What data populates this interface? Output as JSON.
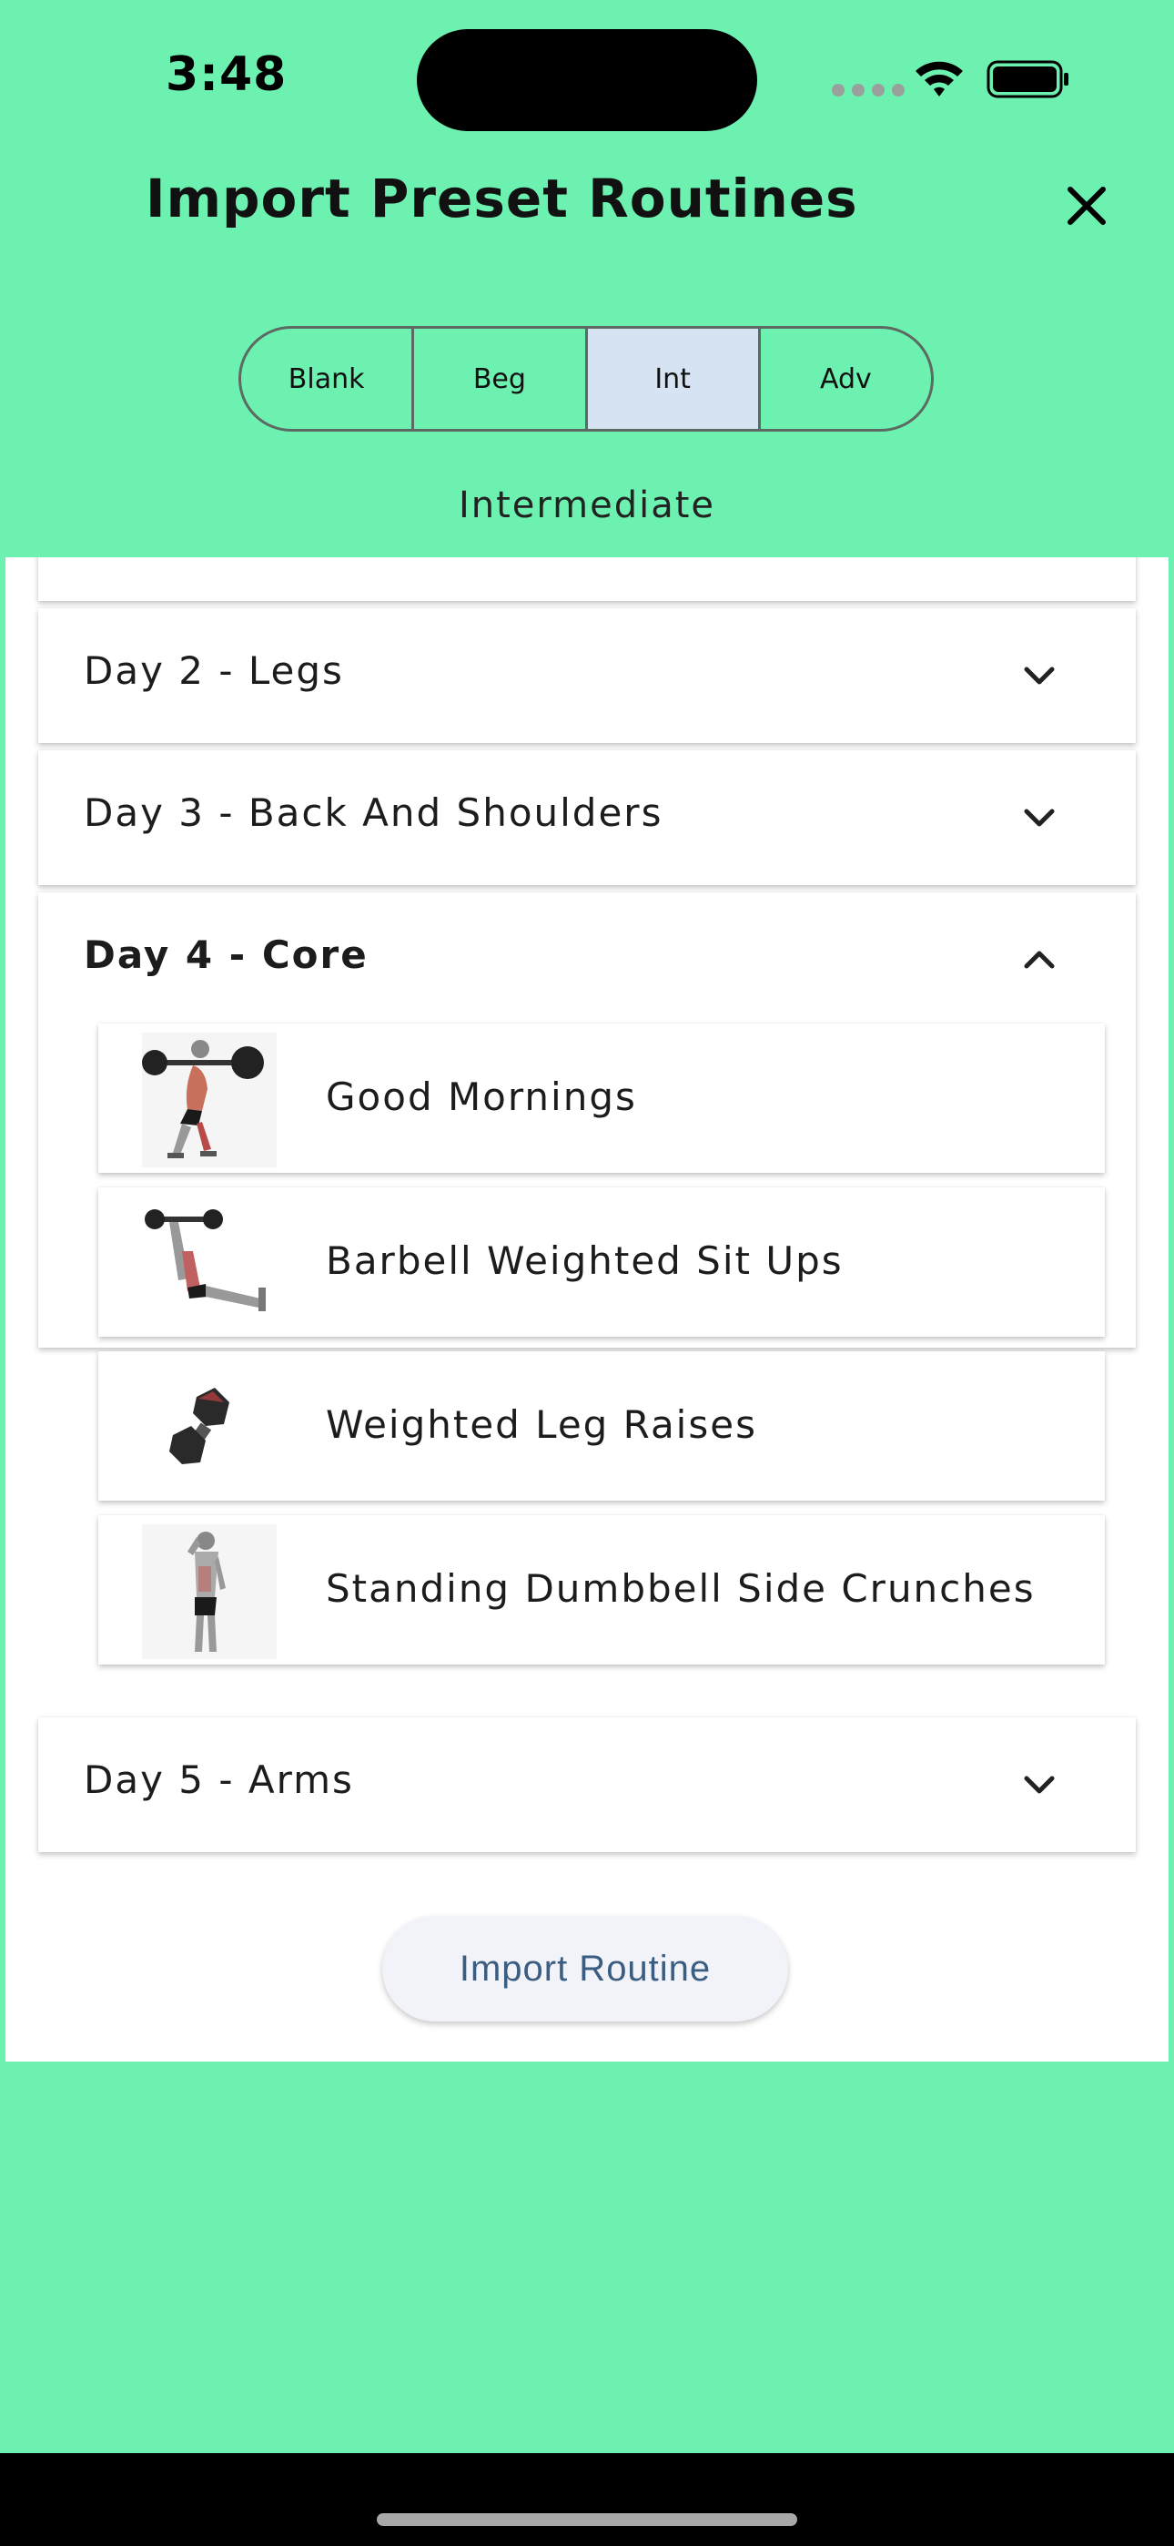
{
  "status_bar": {
    "time": "3:48"
  },
  "header": {
    "title": "Import Preset Routines"
  },
  "segments": [
    {
      "label": "Blank",
      "selected": false
    },
    {
      "label": "Beg",
      "selected": false
    },
    {
      "label": "Int",
      "selected": true
    },
    {
      "label": "Adv",
      "selected": false
    }
  ],
  "level_label": "Intermediate",
  "days": [
    {
      "title": "Day 2 - Legs",
      "expanded": false
    },
    {
      "title": "Day 3 - Back And Shoulders",
      "expanded": false
    },
    {
      "title": "Day 4 - Core",
      "expanded": true
    },
    {
      "title": "Day 5 - Arms",
      "expanded": false
    }
  ],
  "exercises": [
    {
      "name": "Good Mornings",
      "icon": "barbell-squat-figure-icon"
    },
    {
      "name": "Barbell Weighted Sit Ups",
      "icon": "barbell-situp-figure-icon"
    },
    {
      "name": "Weighted Leg Raises",
      "icon": "dumbbell-icon"
    },
    {
      "name": "Standing Dumbbell Side Crunches",
      "icon": "side-crunch-figure-icon"
    }
  ],
  "import_button": "Import Routine",
  "colors": {
    "background": "#6cf1b0",
    "selected_segment": "#d6e3f2",
    "button_text": "#3b5d82"
  }
}
